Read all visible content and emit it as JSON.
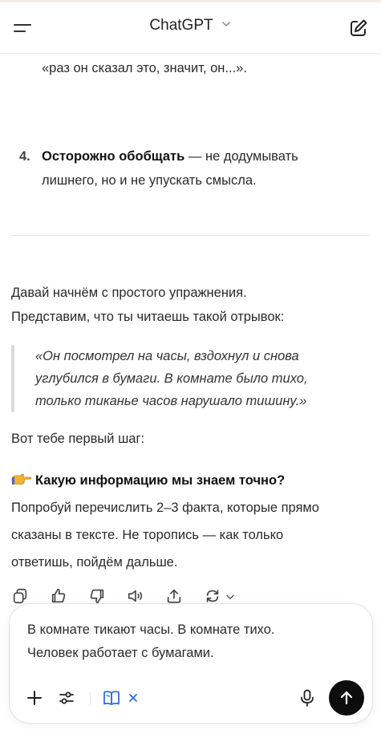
{
  "header": {
    "title": "ChatGPT",
    "menu_icon": "hamburger-icon",
    "new_chat_icon": "compose-icon",
    "title_chevron_icon": "chevron-down-icon"
  },
  "message": {
    "list_item_3_tail": "«раз он сказал это, значит, он...».",
    "list_item_4": {
      "number": "4.",
      "bold": "Осторожно обобщать",
      "rest": " — не додумывать",
      "line2": "лишнего, но и не упускать смысла."
    },
    "intro_line1": "Давай начнём с простого упражнения.",
    "intro_line2": "Представим, что ты читаешь такой отрывок:",
    "quote_lines": [
      "«Он посмотрел на часы, вздохнул и снова",
      "углубился в бумаги. В комнате было тихо,",
      "только тиканье часов нарушало тишину.»"
    ],
    "first_step": "Вот тебе первый шаг:",
    "question_bold": "Какую информацию мы знаем точно?",
    "instruction_lines": [
      "Попробуй перечислить 2–3 факта, которые прямо",
      "сказаны в тексте. Не торопись — как только",
      "ответишь, пойдём дальше."
    ]
  },
  "actions": {
    "icons": [
      "copy-icon",
      "thumbs-up-icon",
      "thumbs-down-icon",
      "read-aloud-icon",
      "share-icon",
      "regenerate-icon"
    ]
  },
  "composer": {
    "text": "В комнате тикают часы. В комнате тихо.\nЧеловек работает с бумагами.",
    "icons": [
      "plus-icon",
      "tools-icon",
      "book-icon",
      "close-icon",
      "mic-icon",
      "arrow-up-icon"
    ]
  },
  "colors": {
    "accent_blue": "#2f6fe0",
    "send_button": "#0d0d0d",
    "quote_bar": "#d9d9d9"
  }
}
